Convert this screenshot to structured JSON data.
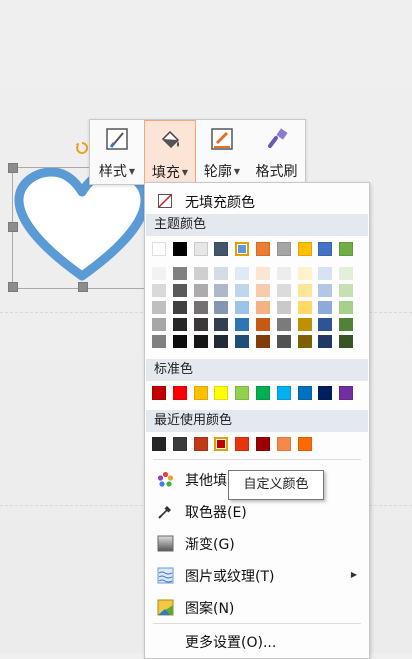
{
  "toolbar": {
    "style_label": "样式",
    "fill_label": "填充",
    "outline_label": "轮廓",
    "format_painter_label": "格式刷"
  },
  "fill_menu": {
    "no_fill_label": "无填充颜色",
    "theme_colors_label": "主题颜色",
    "standard_colors_label": "标准色",
    "recent_colors_label": "最近使用颜色",
    "theme_top_colors": [
      "#ffffff",
      "#000000",
      "#e7e6e6",
      "#44546a",
      "#5b9bd5",
      "#ed7d31",
      "#a5a5a5",
      "#ffc000",
      "#4472c4",
      "#70ad47"
    ],
    "theme_top_selected_index": 4,
    "theme_shade_columns": [
      [
        "#f2f2f2",
        "#d9d9d9",
        "#bfbfbf",
        "#a6a6a6",
        "#808080"
      ],
      [
        "#808080",
        "#595959",
        "#404040",
        "#262626",
        "#0d0d0d"
      ],
      [
        "#d0cece",
        "#aeabab",
        "#757171",
        "#3a3838",
        "#171616"
      ],
      [
        "#d6dce4",
        "#adb9ca",
        "#8497b0",
        "#333f4f",
        "#222a35"
      ],
      [
        "#deebf6",
        "#bdd7ee",
        "#9dc3e6",
        "#2e75b5",
        "#1f4e79"
      ],
      [
        "#fbe5d5",
        "#f7cbac",
        "#f4b183",
        "#c55a11",
        "#833c0b"
      ],
      [
        "#ededed",
        "#dbdbdb",
        "#c9c9c9",
        "#7b7b7b",
        "#525252"
      ],
      [
        "#fff2cc",
        "#fee599",
        "#ffd965",
        "#bf9000",
        "#7f6000"
      ],
      [
        "#d9e2f3",
        "#b4c6e7",
        "#8eaadb",
        "#2f5496",
        "#1f3864"
      ],
      [
        "#e2efd9",
        "#c5e0b3",
        "#a8d08d",
        "#538135",
        "#375623"
      ]
    ],
    "standard_colors": [
      "#c00000",
      "#ff0000",
      "#ffc000",
      "#ffff00",
      "#92d050",
      "#00b050",
      "#00b0f0",
      "#0070c0",
      "#002060",
      "#7030a0"
    ],
    "recent_colors": [
      "#262626",
      "#3a3a3a",
      "#c0391b",
      "#c00000",
      "#e8330c",
      "#9b0000",
      "#f4894a",
      "#ff6a00"
    ],
    "recent_selected_index": 3,
    "items": {
      "more_colors_label": "其他填",
      "eyedropper_label": "取色器(E)",
      "gradient_label": "渐变(G)",
      "picture_texture_label": "图片或纹理(T)",
      "pattern_label": "图案(N)",
      "more_settings_label": "更多设置(O)..."
    }
  },
  "tooltip": "自定义颜色",
  "colors": {
    "heart_stroke": "#5b9bd5",
    "active_button_bg": "#fce4d6",
    "section_header_bg": "#e4e8ef"
  }
}
